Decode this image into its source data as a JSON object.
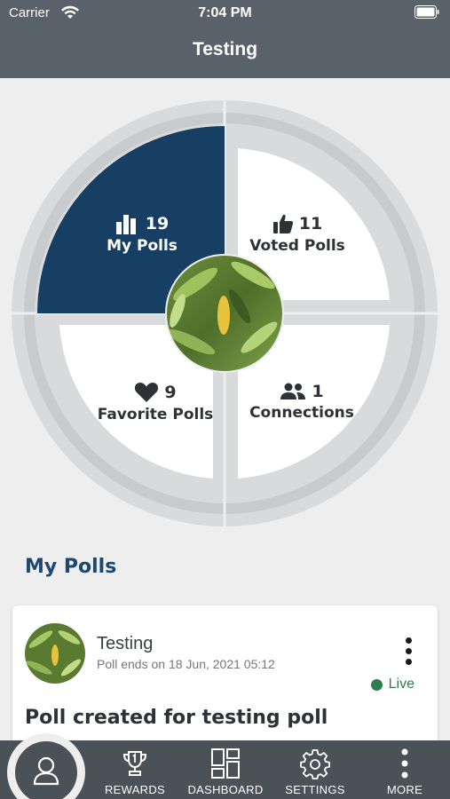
{
  "status_bar": {
    "carrier": "Carrier",
    "time": "7:04 PM"
  },
  "nav": {
    "title": "Testing"
  },
  "dashboard": {
    "my_polls": {
      "count": "19",
      "label": "My Polls",
      "icon": "bar-chart-icon"
    },
    "voted_polls": {
      "count": "11",
      "label": "Voted Polls",
      "icon": "thumbs-up-icon"
    },
    "favorite_polls": {
      "count": "9",
      "label": "Favorite Polls",
      "icon": "heart-icon"
    },
    "connections": {
      "count": "1",
      "label": "Connections",
      "icon": "users-icon"
    },
    "colors": {
      "selected": "#173f63",
      "ring": "#d9dadb",
      "track": "#c8cbce"
    }
  },
  "section": {
    "title": "My Polls"
  },
  "poll": {
    "title": "Testing",
    "ends": "Poll ends on 18 Jun, 2021 05:12",
    "status": "Live",
    "question": "Poll created for testing poll",
    "status_color": "#2e7d4f"
  },
  "tabs": {
    "rewards": "REWARDS",
    "dashboard": "DASHBOARD",
    "settings": "SETTINGS",
    "more": "MORE"
  }
}
